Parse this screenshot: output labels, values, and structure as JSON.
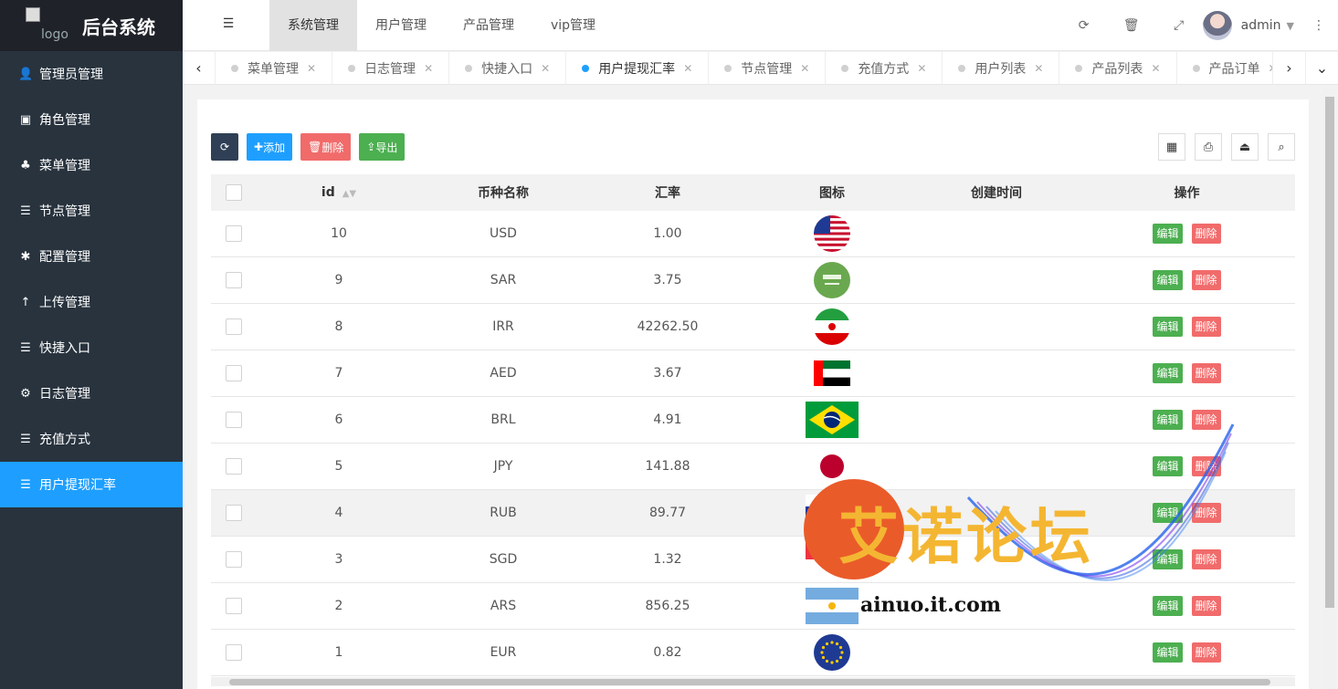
{
  "app": {
    "logo_alt": "logo",
    "title": "后台系统"
  },
  "sidebar": {
    "items": [
      {
        "label": "管理员管理",
        "icon": "user-icon"
      },
      {
        "label": "角色管理",
        "icon": "id-card-icon"
      },
      {
        "label": "菜单管理",
        "icon": "tree-icon"
      },
      {
        "label": "节点管理",
        "icon": "list-icon"
      },
      {
        "label": "配置管理",
        "icon": "asterisk-icon"
      },
      {
        "label": "上传管理",
        "icon": "arrow-up-icon"
      },
      {
        "label": "快捷入口",
        "icon": "list-icon"
      },
      {
        "label": "日志管理",
        "icon": "gear-icon"
      },
      {
        "label": "充值方式",
        "icon": "list-icon"
      },
      {
        "label": "用户提现汇率",
        "icon": "list-icon",
        "active": true
      }
    ]
  },
  "header": {
    "nav": [
      "系统管理",
      "用户管理",
      "产品管理",
      "vip管理"
    ],
    "active_nav": "系统管理",
    "username": "admin"
  },
  "tabs": [
    {
      "label": "菜单管理"
    },
    {
      "label": "日志管理"
    },
    {
      "label": "快捷入口"
    },
    {
      "label": "用户提现汇率",
      "active": true
    },
    {
      "label": "节点管理"
    },
    {
      "label": "充值方式"
    },
    {
      "label": "用户列表"
    },
    {
      "label": "产品列表"
    },
    {
      "label": "产品订单"
    }
  ],
  "toolbar": {
    "add_label": "添加",
    "delete_label": "删除",
    "export_label": "导出"
  },
  "table": {
    "columns": {
      "id": "id",
      "name": "币种名称",
      "rate": "汇率",
      "icon": "图标",
      "created": "创建时间",
      "actions": "操作"
    },
    "edit_label": "编辑",
    "delete_label": "删除",
    "rows": [
      {
        "id": "10",
        "name": "USD",
        "rate": "1.00",
        "flag": "us"
      },
      {
        "id": "9",
        "name": "SAR",
        "rate": "3.75",
        "flag": "sa"
      },
      {
        "id": "8",
        "name": "IRR",
        "rate": "42262.50",
        "flag": "ir"
      },
      {
        "id": "7",
        "name": "AED",
        "rate": "3.67",
        "flag": "ae"
      },
      {
        "id": "6",
        "name": "BRL",
        "rate": "4.91",
        "flag": "br"
      },
      {
        "id": "5",
        "name": "JPY",
        "rate": "141.88",
        "flag": "jp"
      },
      {
        "id": "4",
        "name": "RUB",
        "rate": "89.77",
        "flag": "ru"
      },
      {
        "id": "3",
        "name": "SGD",
        "rate": "1.32",
        "flag": "sg"
      },
      {
        "id": "2",
        "name": "ARS",
        "rate": "856.25",
        "flag": "ar"
      },
      {
        "id": "1",
        "name": "EUR",
        "rate": "0.82",
        "flag": "eu"
      }
    ]
  },
  "watermark": {
    "text": "艾诺论坛",
    "domain": "ainuo.it.com"
  }
}
